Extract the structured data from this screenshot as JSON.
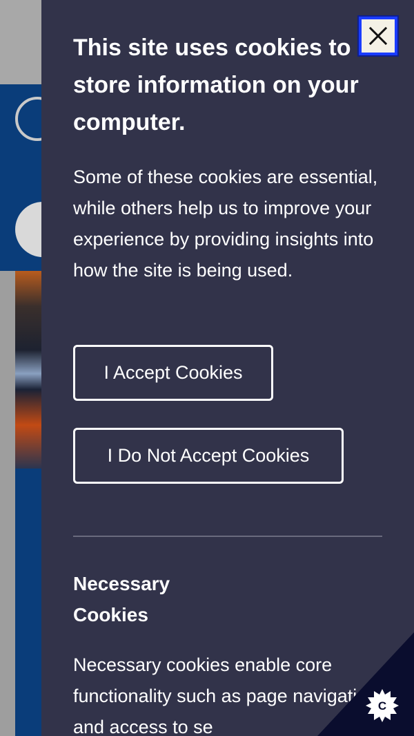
{
  "cookie_banner": {
    "title": "This site uses cookies to store information on your computer.",
    "description": "Some of these cookies are essential, while others help us to improve your experience by providing insights into how the site is being used.",
    "accept_label": "I Accept Cookies",
    "reject_label": "I Do Not Accept Cookies",
    "close_icon": "close-icon",
    "necessary_section": {
      "title": "Necessary Cookies",
      "text": "Necessary cookies enable core functionality such as page navigation and access to se"
    },
    "settings_icon": "cookie-settings-icon",
    "settings_icon_letter": "C"
  },
  "colors": {
    "panel_bg": "#32334a",
    "close_border": "#1a3cff",
    "page_blue": "#0a3d7a"
  }
}
